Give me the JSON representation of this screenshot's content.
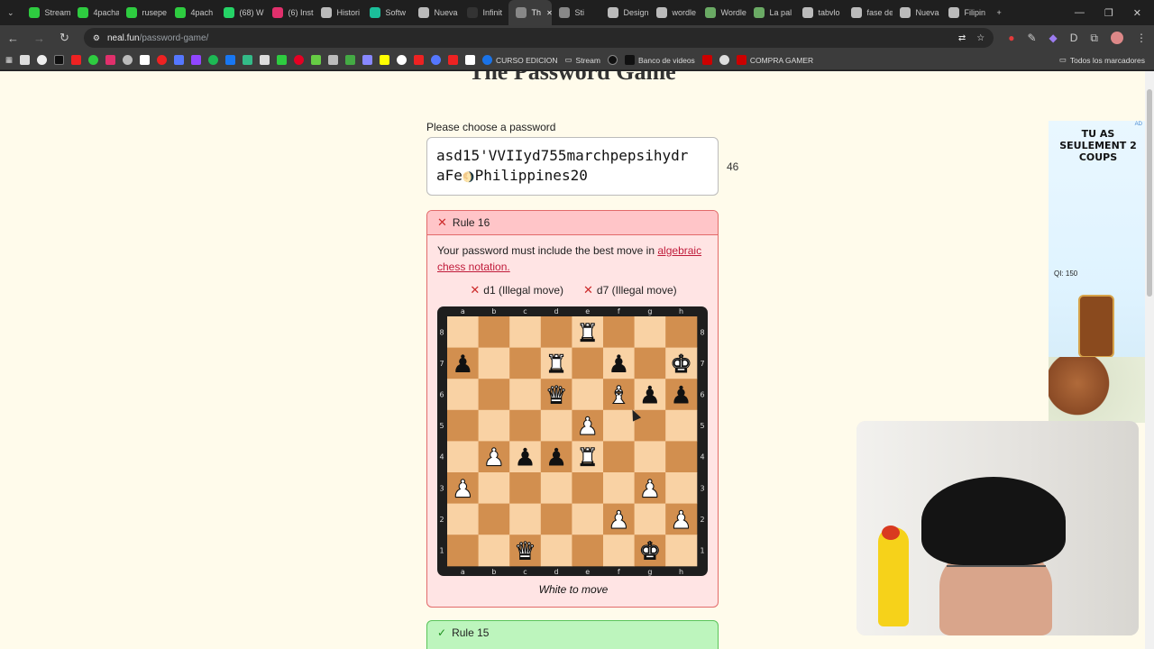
{
  "browser": {
    "tabs": [
      {
        "label": "Stream",
        "color": "#2ecc40"
      },
      {
        "label": "4pacha",
        "color": "#2ecc40"
      },
      {
        "label": "rusepe",
        "color": "#2ecc40"
      },
      {
        "label": "4pach",
        "color": "#2ecc40"
      },
      {
        "label": "(68) W",
        "color": "#25d366"
      },
      {
        "label": "(6) Inst",
        "color": "#e1306c"
      },
      {
        "label": "Histori",
        "color": "#bbbbbb"
      },
      {
        "label": "Softw",
        "color": "#1bbf9a"
      },
      {
        "label": "Nueva",
        "color": "#bbbbbb"
      },
      {
        "label": "Infinit",
        "color": "#333333"
      },
      {
        "label": "Th",
        "color": "#888888",
        "active": true
      },
      {
        "label": "Sti",
        "color": "#888888"
      },
      {
        "label": "Design",
        "color": "#bbbbbb"
      },
      {
        "label": "wordle",
        "color": "#bbbbbb"
      },
      {
        "label": "Wordle",
        "color": "#6aaa64"
      },
      {
        "label": "La pal",
        "color": "#6aaa64"
      },
      {
        "label": "tabvlo",
        "color": "#bbbbbb"
      },
      {
        "label": "fase de",
        "color": "#bbbbbb"
      },
      {
        "label": "Nueva",
        "color": "#bbbbbb"
      },
      {
        "label": "Filipin",
        "color": "#bbbbbb"
      }
    ],
    "new_tab": "+",
    "window_controls": [
      "—",
      "❐",
      "✕"
    ],
    "url_host": "neal.fun",
    "url_path": "/password-game/",
    "bookmarks_visible": [
      "CURSO EDICION",
      "Stream",
      "Banco de videos",
      "COMPRA GAMER"
    ],
    "all_bookmarks": "Todos los marcadores"
  },
  "page": {
    "title_clipped": "The Password Game",
    "password_label": "Please choose a password",
    "password_value_line1": "asd15'VVIIyd755marchpepsihydr",
    "password_value_line2_before": "aFe",
    "password_value_line2_emoji": "🌖",
    "password_value_line2_after": "Philippines20",
    "char_count": "46"
  },
  "rule16": {
    "title": "Rule 16",
    "status": "failed",
    "description": "Your password must include the best move in",
    "link_text": "algebraic chess notation.",
    "moves": [
      {
        "text": "d1 (Illegal move)"
      },
      {
        "text": "d7 (Illegal move)"
      }
    ],
    "caption": "White to move",
    "board": {
      "files": [
        "a",
        "b",
        "c",
        "d",
        "e",
        "f",
        "g",
        "h"
      ],
      "ranks": [
        "8",
        "7",
        "6",
        "5",
        "4",
        "3",
        "2",
        "1"
      ],
      "light": "#f9d2a4",
      "dark": "#d28f4f",
      "pieces": [
        {
          "sq": "e8",
          "p": "♜",
          "c": "w"
        },
        {
          "sq": "a7",
          "p": "♟",
          "c": "b"
        },
        {
          "sq": "d7",
          "p": "♜",
          "c": "w"
        },
        {
          "sq": "f7",
          "p": "♟",
          "c": "b"
        },
        {
          "sq": "h7",
          "p": "♚",
          "c": "w"
        },
        {
          "sq": "d6",
          "p": "♛",
          "c": "w"
        },
        {
          "sq": "f6",
          "p": "♝",
          "c": "w"
        },
        {
          "sq": "g6",
          "p": "♟",
          "c": "b"
        },
        {
          "sq": "h6",
          "p": "♟",
          "c": "b"
        },
        {
          "sq": "e5",
          "p": "♟",
          "c": "w"
        },
        {
          "sq": "b4",
          "p": "♟",
          "c": "w"
        },
        {
          "sq": "c4",
          "p": "♟",
          "c": "b"
        },
        {
          "sq": "d4",
          "p": "♟",
          "c": "b"
        },
        {
          "sq": "e4",
          "p": "♜",
          "c": "w"
        },
        {
          "sq": "a3",
          "p": "♟",
          "c": "w"
        },
        {
          "sq": "g3",
          "p": "♟",
          "c": "w"
        },
        {
          "sq": "f2",
          "p": "♟",
          "c": "w"
        },
        {
          "sq": "h2",
          "p": "♟",
          "c": "w"
        },
        {
          "sq": "c1",
          "p": "♛",
          "c": "w"
        },
        {
          "sq": "g1",
          "p": "♚",
          "c": "w"
        }
      ]
    }
  },
  "rule15": {
    "title": "Rule 15",
    "status": "passed"
  },
  "ad": {
    "headline": "TU AS SEULEMENT 2 COUPS",
    "qi": "QI: 150",
    "corner": "AD"
  },
  "webcam": {
    "label": "webcam overlay"
  }
}
